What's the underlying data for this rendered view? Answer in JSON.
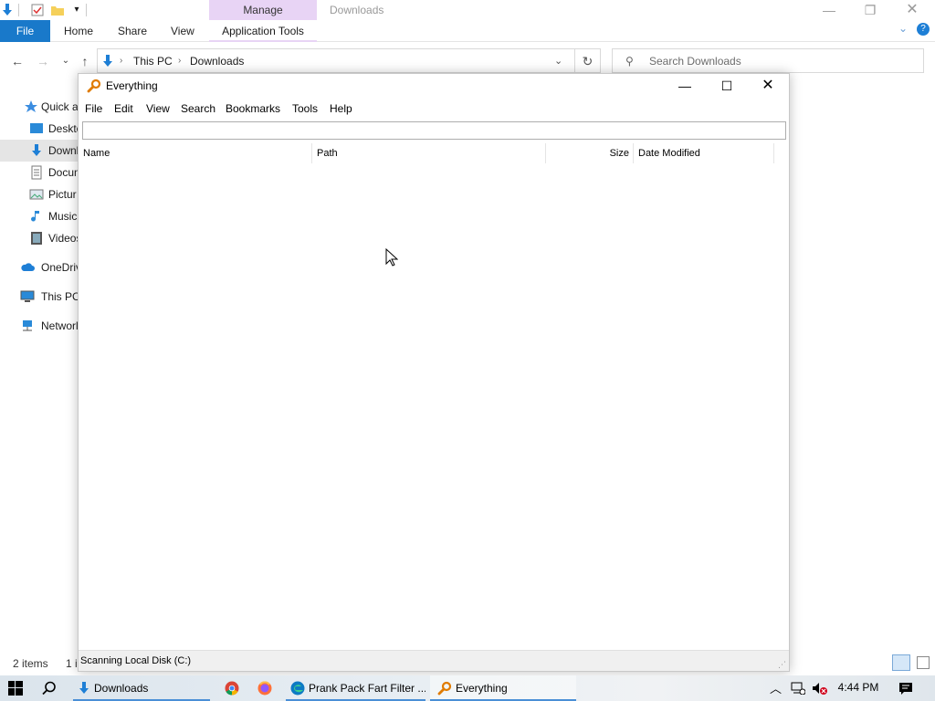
{
  "explorer": {
    "title": "Downloads",
    "manage_tab": "Manage",
    "ribbon": {
      "file": "File",
      "tabs": [
        "Home",
        "Share",
        "View"
      ],
      "app_tools": "Application Tools"
    },
    "address": {
      "segments": [
        "This PC",
        "Downloads"
      ]
    },
    "search_placeholder": "Search Downloads",
    "nav": [
      {
        "label": "Quick a",
        "icon": "star-icon"
      },
      {
        "label": "Deskto",
        "icon": "desktop-icon"
      },
      {
        "label": "Downl",
        "icon": "download-icon",
        "selected": true
      },
      {
        "label": "Docum",
        "icon": "document-icon"
      },
      {
        "label": "Pictur",
        "icon": "picture-icon"
      },
      {
        "label": "Music",
        "icon": "music-icon"
      },
      {
        "label": "Videos",
        "icon": "video-icon"
      },
      {
        "label": "OneDriv",
        "icon": "cloud-icon"
      },
      {
        "label": "This PC",
        "icon": "computer-icon"
      },
      {
        "label": "Networl",
        "icon": "network-icon"
      }
    ],
    "status": {
      "items": "2 items",
      "selection": "1 i"
    }
  },
  "everything": {
    "title": "Everything",
    "menu": [
      "File",
      "Edit",
      "View",
      "Search",
      "Bookmarks",
      "Tools",
      "Help"
    ],
    "search_value": "",
    "columns": [
      "Name",
      "Path",
      "Size",
      "Date Modified"
    ],
    "status": "Scanning Local Disk (C:)"
  },
  "taskbar": {
    "apps": [
      {
        "label": "Downloads",
        "icon": "folder-download-icon"
      },
      {
        "label": "",
        "icon": "chrome-icon"
      },
      {
        "label": "",
        "icon": "firefox-icon"
      },
      {
        "label": "Prank Pack Fart Filter ...",
        "icon": "edge-icon"
      },
      {
        "label": "Everything",
        "icon": "everything-icon"
      }
    ],
    "clock": "4:44 PM"
  },
  "colors": {
    "accent": "#1979ca",
    "manage_tab": "#e8d4f5",
    "taskbar_underline": "#4a8fd6",
    "everything_icon": "#e07b00"
  }
}
